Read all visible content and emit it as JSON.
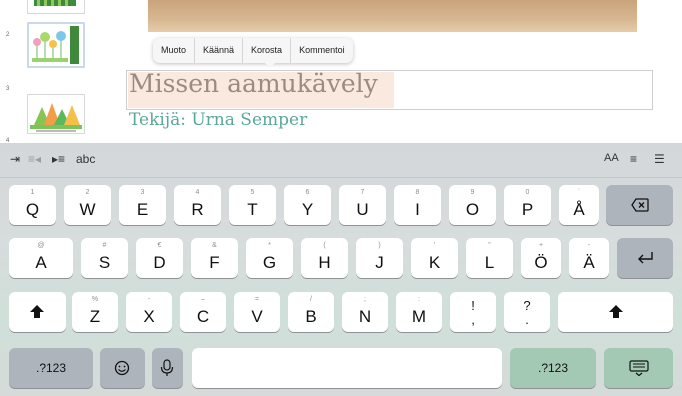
{
  "sidebar": {
    "slides": [
      {
        "number": "2"
      },
      {
        "number": "3"
      }
    ]
  },
  "context_menu": {
    "items": [
      "Muoto",
      "Käännä",
      "Korosta",
      "Kommentoi"
    ]
  },
  "slide": {
    "title": "Missen aamukävely",
    "author": "Tekijä: Urna Semper"
  },
  "shortcut_bar": {
    "abc_label": "abc",
    "font_size_label": "AA"
  },
  "keyboard": {
    "row1": [
      {
        "hint": "1",
        "main": "Q"
      },
      {
        "hint": "2",
        "main": "W"
      },
      {
        "hint": "3",
        "main": "E"
      },
      {
        "hint": "4",
        "main": "R"
      },
      {
        "hint": "5",
        "main": "T"
      },
      {
        "hint": "6",
        "main": "Y"
      },
      {
        "hint": "7",
        "main": "U"
      },
      {
        "hint": "8",
        "main": "I"
      },
      {
        "hint": "9",
        "main": "O"
      },
      {
        "hint": "0",
        "main": "P"
      },
      {
        "hint": "´",
        "main": "Å"
      }
    ],
    "row2": [
      {
        "hint": "@",
        "main": "A"
      },
      {
        "hint": "#",
        "main": "S"
      },
      {
        "hint": "€",
        "main": "D"
      },
      {
        "hint": "&",
        "main": "F"
      },
      {
        "hint": "*",
        "main": "G"
      },
      {
        "hint": "(",
        "main": "H"
      },
      {
        "hint": ")",
        "main": "J"
      },
      {
        "hint": "'",
        "main": "K"
      },
      {
        "hint": "\"",
        "main": "L"
      },
      {
        "hint": "+",
        "main": "Ö"
      },
      {
        "hint": "-",
        "main": "Ä"
      }
    ],
    "row3": [
      {
        "hint": "%",
        "main": "Z"
      },
      {
        "hint": "-",
        "main": "X"
      },
      {
        "hint": "–",
        "main": "C"
      },
      {
        "hint": "=",
        "main": "V"
      },
      {
        "hint": "/",
        "main": "B"
      },
      {
        "hint": ";",
        "main": "N"
      },
      {
        "hint": ":",
        "main": "M"
      }
    ],
    "punct1": {
      "top": "!",
      "bottom": ","
    },
    "punct2": {
      "top": "?",
      "bottom": "."
    },
    "numbers_label": ".?123"
  }
}
